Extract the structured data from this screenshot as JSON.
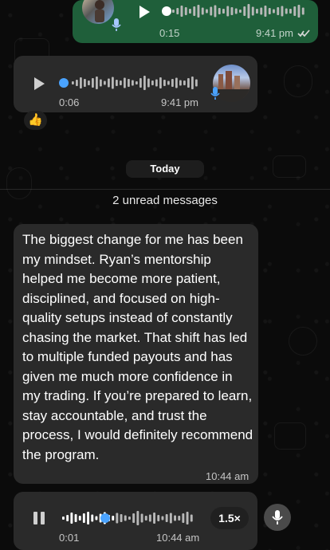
{
  "voice_notes": [
    {
      "duration": "0:15",
      "timestamp": "9:41 pm",
      "status": "read",
      "progress": 0.0
    },
    {
      "duration": "0:06",
      "timestamp": "9:41 pm",
      "progress": 0.0
    },
    {
      "duration": "0:01",
      "timestamp": "10:44 am",
      "progress": 0.38,
      "speed": "1.5×"
    }
  ],
  "reaction": "👍",
  "date_chip": "Today",
  "unread": "2 unread messages",
  "message": {
    "text": "The biggest change for me has been my mindset. Ryan’s mentorship helped me become more patient, disciplined, and focused on high-quality setups instead of constantly chasing the market. That shift has led to multiple funded payouts and has given me much more confidence in my trading. If you’re prepared to learn, stay accountable, and trust the process, I would definitely recommend the program.",
    "timestamp": "10:44 am"
  },
  "colors": {
    "outgoing_bubble": "#1f5f3a",
    "incoming_bubble": "#2a2a2a",
    "accent": "#4aa3ff"
  },
  "icons": {
    "play": "play-icon",
    "pause": "pause-icon",
    "read_receipt": "double-check-icon",
    "mic": "microphone-icon"
  }
}
